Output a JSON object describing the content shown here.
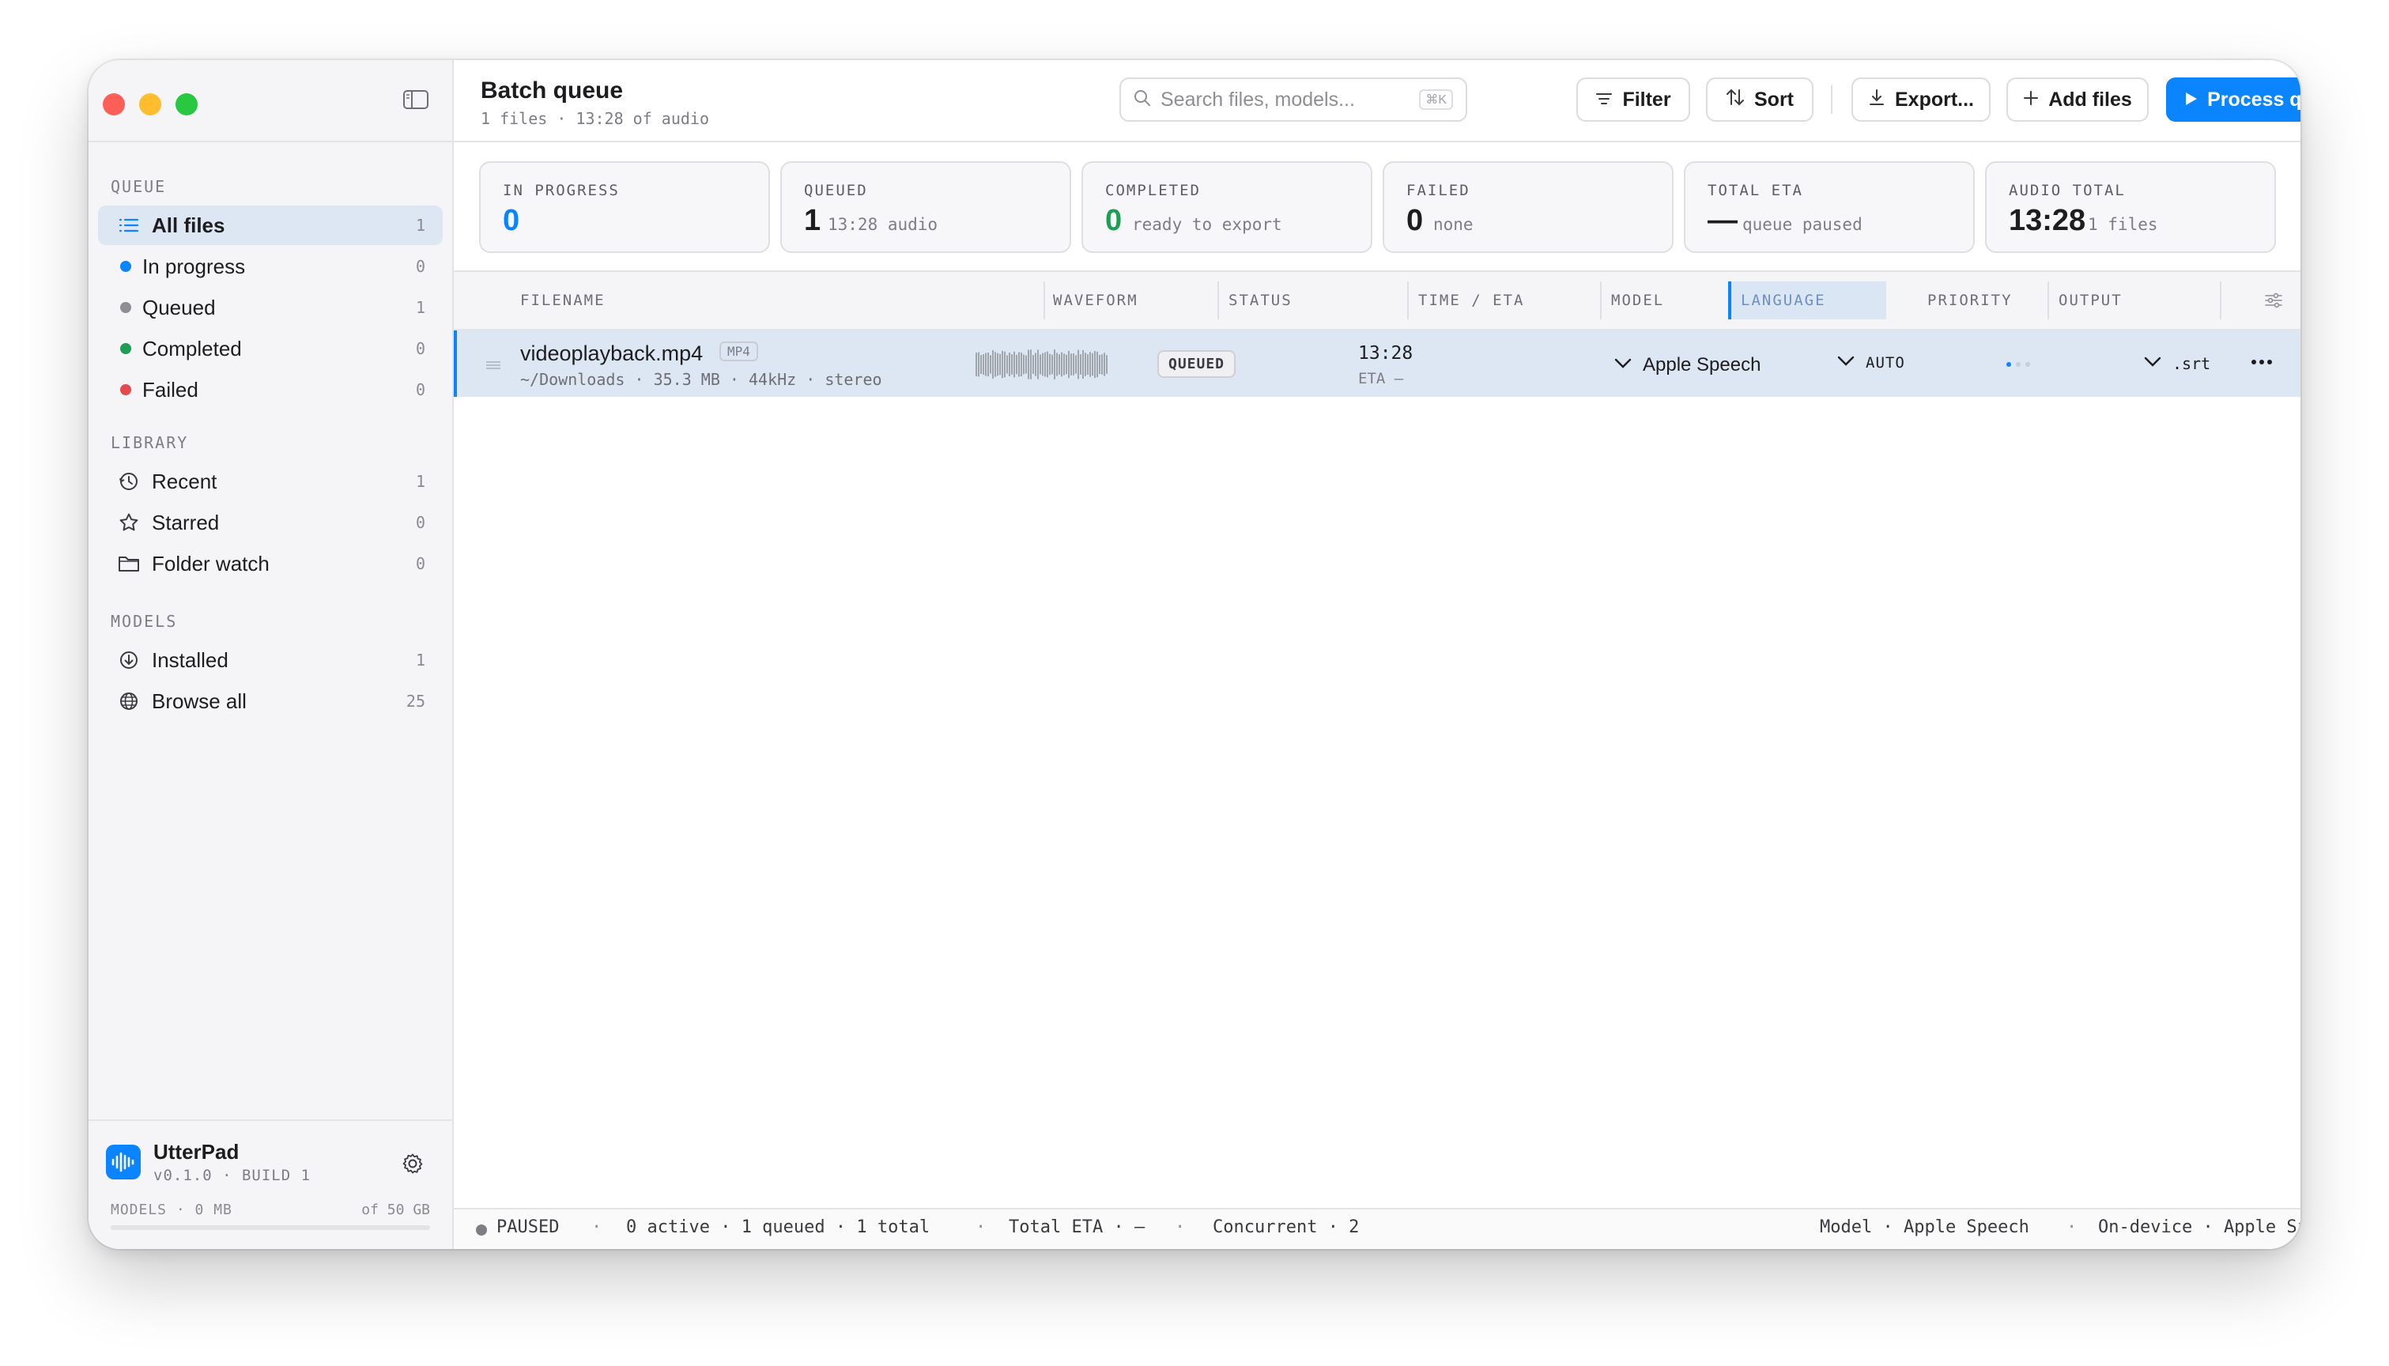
{
  "sidebar": {
    "toggle_icon": "sidebar-toggle-icon",
    "sections": {
      "queue": "QUEUE",
      "library": "LIBRARY",
      "models": "MODELS"
    },
    "queue_items": [
      {
        "label": "All files",
        "count": "1",
        "icon": "list-icon",
        "active": true
      },
      {
        "label": "In progress",
        "count": "0",
        "dot": "#0a84ff"
      },
      {
        "label": "Queued",
        "count": "1",
        "dot": "#8e8e93"
      },
      {
        "label": "Completed",
        "count": "0",
        "dot": "#1f9d55"
      },
      {
        "label": "Failed",
        "count": "0",
        "dot": "#e5484d"
      }
    ],
    "library_items": [
      {
        "label": "Recent",
        "count": "1",
        "icon": "clock-icon"
      },
      {
        "label": "Starred",
        "count": "0",
        "icon": "star-icon"
      },
      {
        "label": "Folder watch",
        "count": "0",
        "icon": "folder-icon"
      }
    ],
    "model_items": [
      {
        "label": "Installed",
        "count": "1",
        "icon": "download-circle-icon"
      },
      {
        "label": "Browse all",
        "count": "25",
        "icon": "globe-icon"
      }
    ],
    "brand": {
      "name": "UtterPad",
      "version": "v0.1.0 · BUILD 1",
      "storage_left": "MODELS · 0 MB",
      "storage_right": "of 50 GB",
      "storage_used": 0
    }
  },
  "header": {
    "title": "Batch queue",
    "subtitle": "1 files · 13:28 of audio",
    "search_placeholder": "Search files, models...",
    "search_shortcut": "⌘K",
    "filter": "Filter",
    "sort": "Sort",
    "export": "Export...",
    "add_files": "Add files",
    "process": "Process queue"
  },
  "stats": [
    {
      "label": "IN PROGRESS",
      "value": "0",
      "note": "",
      "color": "#0a84ff"
    },
    {
      "label": "QUEUED",
      "value": "1",
      "note": "13:28 audio",
      "color": "#1d1d1f"
    },
    {
      "label": "COMPLETED",
      "value": "0",
      "note": "ready to export",
      "color": "#1f9d55"
    },
    {
      "label": "FAILED",
      "value": "0",
      "note": "none",
      "color": "#1d1d1f"
    },
    {
      "label": "TOTAL ETA",
      "value": "—",
      "note": "queue paused",
      "color": "#1d1d1f"
    },
    {
      "label": "AUDIO TOTAL",
      "value": "13:28",
      "note": "1 files",
      "color": "#1d1d1f"
    }
  ],
  "table": {
    "columns": [
      "FILENAME",
      "WAVEFORM",
      "STATUS",
      "TIME / ETA",
      "MODEL",
      "LANGUAGE",
      "PRIORITY",
      "OUTPUT"
    ],
    "rows": [
      {
        "filename": "videoplayback.mp4",
        "type": "MP4",
        "meta": "~/Downloads · 35.3 MB · 44kHz · stereo",
        "status": "QUEUED",
        "time": "13:28",
        "eta": "ETA —",
        "model": "Apple Speech",
        "language": "AUTO",
        "output": ".srt"
      }
    ]
  },
  "statusbar": {
    "state": "PAUSED",
    "counts": "0 active · 1 queued · 1 total",
    "eta": "Total ETA · —",
    "concurrent": "Concurrent · 2",
    "model": "Model · Apple Speech",
    "device": "On-device · Apple Silicon",
    "separator": "·"
  }
}
